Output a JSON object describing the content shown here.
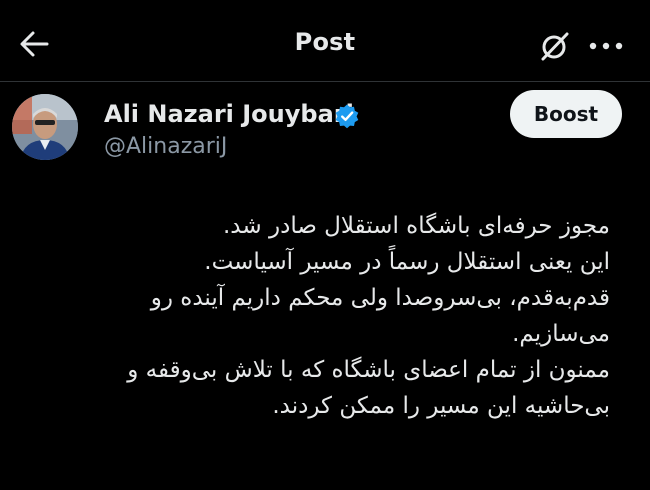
{
  "header": {
    "title": "Post",
    "back_icon": "arrow-left-icon",
    "grok_icon": "grok-icon",
    "more_icon": "more-horizontal-icon"
  },
  "post": {
    "author_name": "Ali Nazari Jouybari",
    "handle": "@AlinazariJ",
    "verified": true,
    "verified_color": "#1d9bf0",
    "boost_label": "Boost",
    "lines": [
      "مجوز حرفه‌ای باشگاه استقلال صادر شد.",
      "این یعنی استقلال رسماً در مسیر آسیاست.",
      "قدم‌به‌قدم، بی‌سروصدا ولی محکم داریم آینده رو",
      "می‌سازیم.",
      "ممنون از تمام اعضای باشگاه که با تلاش بی‌وقفه و",
      "بی‌حاشیه این مسیر را ممکن کردند."
    ]
  },
  "colors": {
    "background": "#000000",
    "text": "#e7e9ea",
    "secondary_text": "#8b98a5",
    "button_bg": "#eff3f4"
  }
}
